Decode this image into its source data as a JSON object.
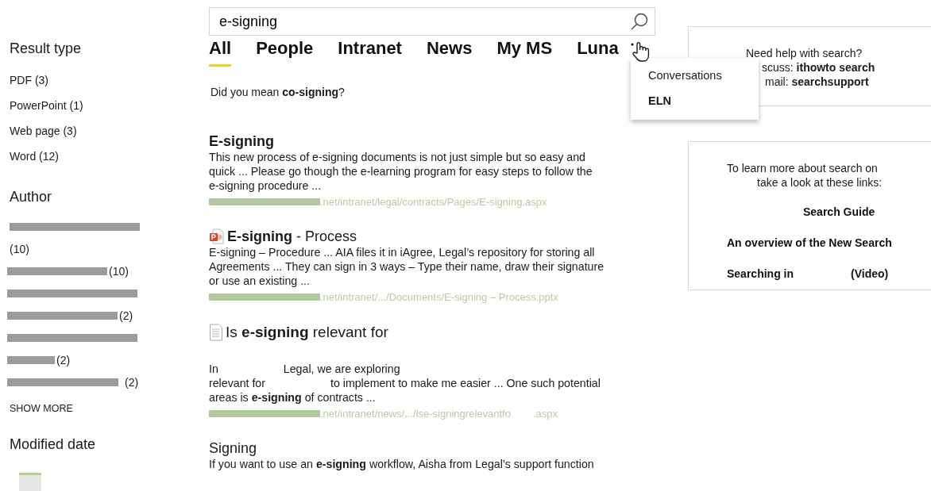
{
  "filters": [
    {
      "title": "Result type",
      "kind": "list",
      "items": [
        "PDF (3)",
        "PowerPoint (1)",
        "Web page (3)",
        "Word (12)"
      ]
    },
    {
      "title": "Author",
      "kind": "redacted",
      "items": [
        "(10)",
        "(10)",
        "(2)",
        "(2)",
        "(2)"
      ],
      "action": "SHOW MORE"
    },
    {
      "title": "Modified date",
      "kind": "histogram"
    }
  ],
  "search": {
    "value": "e-signing"
  },
  "tabs": [
    {
      "label": "All",
      "selected": true
    },
    {
      "label": "People",
      "selected": false
    },
    {
      "label": "Intranet",
      "selected": false
    },
    {
      "label": "News",
      "selected": false
    },
    {
      "label": "My MS",
      "selected": false
    },
    {
      "label": "Luna",
      "selected": false
    }
  ],
  "more_menu": {
    "items": [
      {
        "label": "Conversations",
        "highlighted": false
      },
      {
        "label": "ELN",
        "highlighted": true
      }
    ]
  },
  "suggestion": "Did you mean **co-signing**?",
  "results": [
    {
      "kind": "page",
      "title": "E-signing",
      "title_bold": true,
      "lines": [
        [
          "This new process of e-signing documents is not just simple but so easy and"
        ],
        [
          "quick ... Please go though the e-learning program for easy steps to follow the"
        ],
        [
          "e-signing procedure ..."
        ]
      ],
      "url": [
        ".net/intranet/legal/contracts/Pages/E-signing.aspx"
      ]
    },
    {
      "kind": "pptx",
      "title": "**E-signing** - Process",
      "title_bold": false,
      "lines": [
        [
          "E-signing – Procedure ... AIA files it in iAgree, Legal’s repository for storing all"
        ],
        [
          "Agreements ... They can sign in 3 ways – Type their name, draw their signature"
        ],
        [
          "or use an existing ..."
        ]
      ],
      "url": [
        ".net/intranet/.../Documents/E-signing – Process.pptx"
      ]
    },
    {
      "kind": "doc",
      "title": "Is **e-signing** relevant for",
      "title_bold": false,
      "lines": [
        [
          "In",
          "Legal, we are exploring"
        ],
        [
          "relevant for",
          "to implement to make me easier ... One such potential"
        ],
        [
          "areas is **e-signing** of contracts ..."
        ]
      ],
      "url": [
        ".net/intranet/news/.../lse-signingrelevantfo",
        ".aspx"
      ]
    },
    {
      "kind": "page",
      "title": "Signing",
      "title_bold": false,
      "lines": [
        [
          "If you want to use an **e-signing** workflow, Aisha from Legal’s support function"
        ]
      ]
    }
  ],
  "help": {
    "lines": [
      "Need help with search?",
      "scuss: **ithowto search**",
      "mail: **searchsupport**"
    ]
  },
  "learn": {
    "intro": [
      "To learn more about search on",
      "take a look at these links:"
    ],
    "links": [
      [
        "Search Guide"
      ],
      [
        "An overview of the New Search"
      ],
      [
        "Searching in",
        "(Video)"
      ]
    ]
  }
}
